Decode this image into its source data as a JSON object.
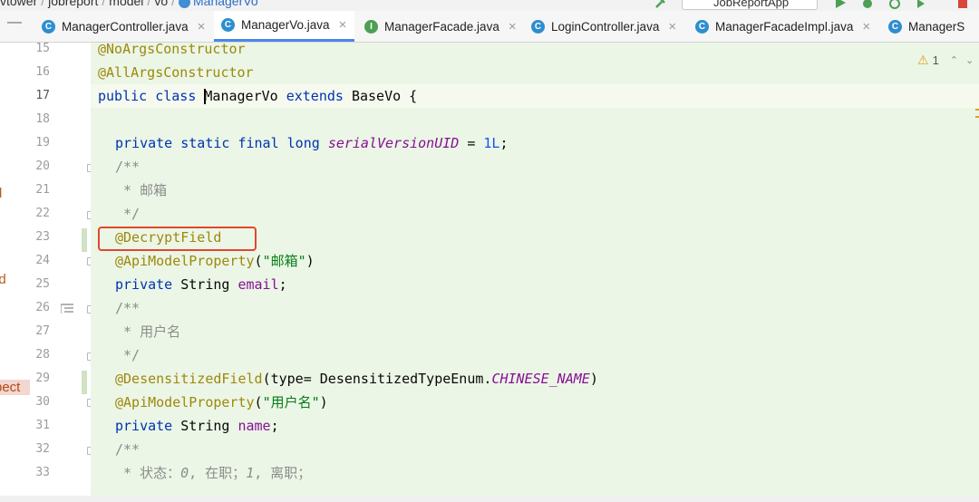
{
  "breadcrumb": {
    "items": [
      "vtower",
      "jobreport",
      "model",
      "vo",
      "ManagerVo"
    ]
  },
  "run_config": {
    "label": "JobReportApp"
  },
  "tabs": [
    {
      "label": "ManagerController.java",
      "icon": "class-icon",
      "icon_glyph": "C",
      "active": false
    },
    {
      "label": "ManagerVo.java",
      "icon": "class-icon",
      "icon_glyph": "C",
      "active": true
    },
    {
      "label": "ManagerFacade.java",
      "icon": "interface-icon",
      "icon_glyph": "I",
      "active": false
    },
    {
      "label": "LoginController.java",
      "icon": "class-icon",
      "icon_glyph": "C",
      "active": false
    },
    {
      "label": "ManagerFacadeImpl.java",
      "icon": "class-icon",
      "icon_glyph": "C",
      "active": false
    },
    {
      "label": "ManagerS",
      "icon": "class-icon",
      "icon_glyph": "C",
      "active": false
    }
  ],
  "tab_close_glyph": "×",
  "left_panel": {
    "items": [
      "t",
      "d",
      "ed",
      "pect"
    ]
  },
  "inspections": {
    "warning_count": "1"
  },
  "editor": {
    "line_numbers": [
      "15",
      "16",
      "17",
      "18",
      "19",
      "20",
      "21",
      "22",
      "23",
      "24",
      "25",
      "26",
      "27",
      "28",
      "29",
      "30",
      "31",
      "32",
      "33"
    ],
    "lines": {
      "l15": "@NoArgsConstructor",
      "l16": "@AllArgsConstructor",
      "l17": {
        "kw": "public class ",
        "name": "ManagerVo",
        "ext": " extends ",
        "base": "BaseVo {"
      },
      "l19": {
        "kw": "private static final long ",
        "field": "serialVersionUID",
        "eq": " = ",
        "num": "1L",
        "end": ";"
      },
      "l20": "/**",
      "l21": " * 邮箱",
      "l22": " */",
      "l23": "@DecryptField",
      "l24": {
        "anno": "@ApiModelProperty",
        "open": "(",
        "str": "\"邮箱\"",
        "close": ")"
      },
      "l25": {
        "kw": "private ",
        "type": "String ",
        "field": "email",
        "end": ";"
      },
      "l26": "/**",
      "l27": " * 用户名",
      "l28": " */",
      "l29": {
        "anno": "@DesensitizedField",
        "mid": "(type= DesensitizedTypeEnum.",
        "const": "CHINESE_NAME",
        "close": ")"
      },
      "l30": {
        "anno": "@ApiModelProperty",
        "open": "(",
        "str": "\"用户名\"",
        "close": ")"
      },
      "l31": {
        "kw": "private ",
        "type": "String ",
        "field": "name",
        "end": ";"
      },
      "l32": "/**",
      "l33": {
        "pre": " * 状态：",
        "n0": "0",
        "mid1": ", 在职；",
        "n1": "1",
        "mid2": ", 离职；"
      }
    }
  },
  "colors": {
    "editor_bg": "#ebf6e6",
    "keyword": "#0033b3",
    "annotation": "#9e880d",
    "string": "#067d17",
    "field": "#871094",
    "number": "#1750eb",
    "highlight_box": "#e1472c"
  }
}
